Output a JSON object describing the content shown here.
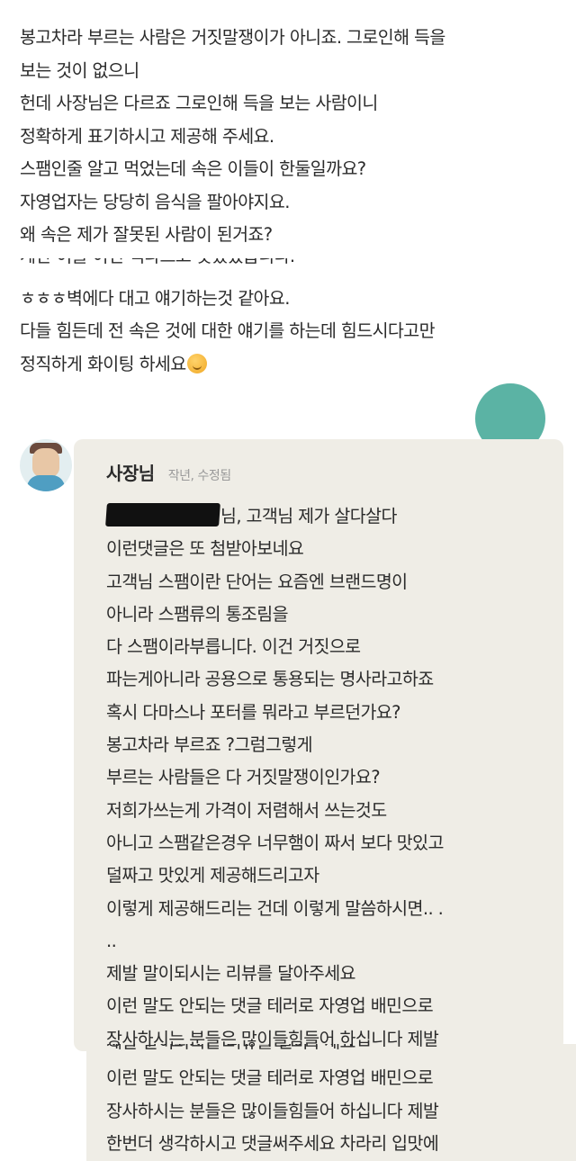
{
  "review": {
    "lines": [
      "봉고차라 부르는 사람은 거짓말쟁이가 아니죠. 그로인해 득을",
      "보는 것이 없으니",
      "헌데 사장님은 다르죠 그로인해 득을 보는 사람이니",
      "정확하게 표기하시고 제공해 주세요.",
      "스팸인줄 알고 먹었는데 속은 이들이 한둘일까요?",
      "자영업자는 당당히 음식을 팔아야지요.",
      "왜 속은 제가 잘못된 사람이 된거죠?"
    ],
    "cut_line": "계란 이줄 이건 색다르고 맛있었습니다.",
    "lines2": [
      "ㅎㅎㅎ벽에다 대고 얘기하는것 같아요.",
      "다들 힘든데 전 속은 것에 대한 얘기를 하는데 힘드시다고만",
      "정직하게 화이팅 하세요"
    ],
    "emoji": "hugging-face-icon"
  },
  "reply": {
    "author": "사장님",
    "meta": "작년, 수정됨",
    "first_line_suffix": "님, 고객님 제가 살다살다",
    "lines": [
      "이런댓글은 또 첨받아보네요",
      "고객님 스팸이란 단어는 요즘엔 브랜드명이",
      "아니라 스팸류의 통조림을",
      "다 스팸이라부릅니다. 이건 거짓으로",
      "파는게아니라 공용으로 통용되는 명사라고하죠",
      "혹시 다마스나 포터를 뭐라고 부르던가요?",
      "봉고차라 부르죠 ?그럼그렇게",
      "부르는 사람들은 다 거짓말쟁이인가요?",
      "저희가쓰는게 가격이 저렴해서 쓰는것도",
      "아니고 스팸같은경우 너무햄이 짜서 보다 맛있고",
      "덜짜고 맛있게 제공해드리고자",
      "이렇게 제공해드리는 건데 이렇게 말씀하시면.. .",
      "..",
      "제발 말이되시는 리뷰를 달아주세요",
      "이런 말도 안되는 댓글 테러로 자영업 배민으로",
      "장사하시는 분들은 많이들힘들어 하십니다 제발"
    ],
    "cut_line": "제발 말이되시는 리뷰를 달아주세요",
    "lines2": [
      "이런 말도 안되는 댓글 테러로 자영업 배민으로",
      "장사하시는 분들은 많이들힘들어 하십니다 제발",
      "한번더 생각하시고 댓글써주세요 차라리 입맛에"
    ]
  }
}
